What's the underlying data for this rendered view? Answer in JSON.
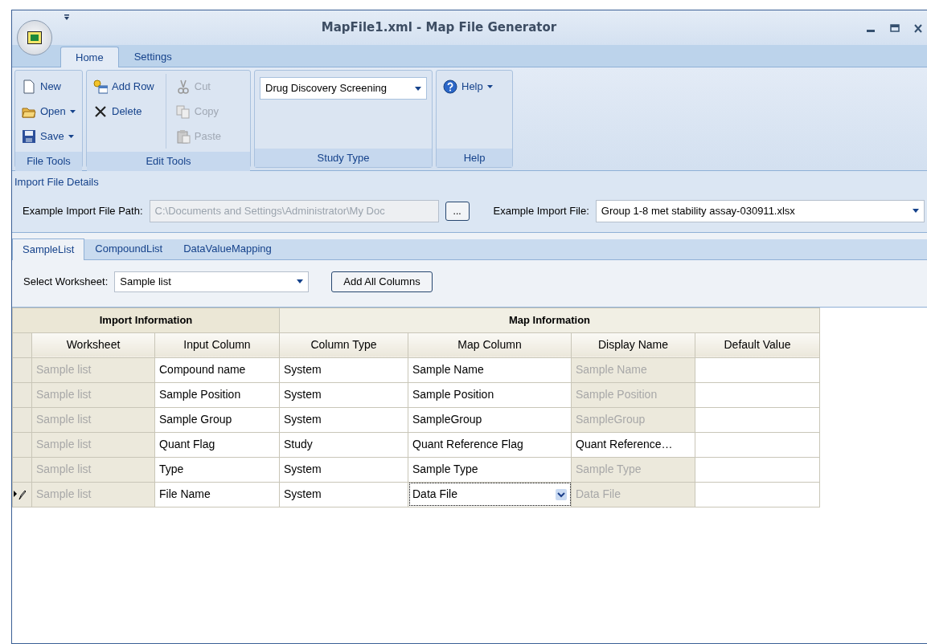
{
  "window": {
    "title": "MapFile1.xml - Map File Generator"
  },
  "ribbon_tabs": [
    {
      "label": "Home",
      "selected": true
    },
    {
      "label": "Settings",
      "selected": false
    }
  ],
  "ribbon_groups": [
    {
      "label": "File Tools",
      "kind": "buttons",
      "items": [
        {
          "label": "New",
          "dropdown": false,
          "disabled": false
        },
        {
          "label": "Open",
          "dropdown": true,
          "disabled": false
        },
        {
          "label": "Save",
          "dropdown": true,
          "disabled": false
        }
      ]
    },
    {
      "label": "Edit Tools",
      "kind": "buttons",
      "items": [
        {
          "label": "Add Row",
          "dropdown": false,
          "disabled": false
        },
        {
          "label": "Delete",
          "dropdown": false,
          "disabled": false
        },
        {
          "label": "Cut",
          "dropdown": false,
          "disabled": true
        },
        {
          "label": "Copy",
          "dropdown": false,
          "disabled": true
        },
        {
          "label": "Paste",
          "dropdown": false,
          "disabled": true
        }
      ]
    },
    {
      "label": "Study Type",
      "kind": "select",
      "value": "Drug Discovery Screening"
    },
    {
      "label": "Help",
      "kind": "buttons",
      "items": [
        {
          "label": "Help",
          "dropdown": true,
          "disabled": false
        }
      ]
    }
  ],
  "import_details": {
    "title": "Import File Details",
    "path_label": "Example Import File Path:",
    "path_value": "C:\\Documents and Settings\\Administrator\\My Doc",
    "browse_button": "...",
    "file_label": "Example Import File:",
    "file_value": "Group 1-8 met stability assay-030911.xlsx"
  },
  "content_tabs": [
    {
      "label": "SampleList",
      "selected": true
    },
    {
      "label": "CompoundList",
      "selected": false
    },
    {
      "label": "DataValueMapping",
      "selected": false
    }
  ],
  "worksheet": {
    "label": "Select Worksheet:",
    "value": "Sample list",
    "add_button": "Add All Columns"
  },
  "grid": {
    "groups": [
      {
        "label": "Import Information",
        "columns": [
          "Worksheet",
          "Input Column"
        ]
      },
      {
        "label": "Map Information",
        "columns": [
          "Column Type",
          "Map Column",
          "Display Name",
          "Default Value"
        ]
      }
    ],
    "rows": [
      {
        "current": false,
        "cells": [
          {
            "text": "Sample list",
            "readonly": true
          },
          {
            "text": "Compound name",
            "readonly": false
          },
          {
            "text": "System",
            "readonly": false
          },
          {
            "text": "Sample Name",
            "readonly": false,
            "editing": false
          },
          {
            "text": "Sample Name",
            "readonly": true
          }
        ]
      },
      {
        "current": false,
        "cells": [
          {
            "text": "Sample list",
            "readonly": true
          },
          {
            "text": "Sample Position",
            "readonly": false
          },
          {
            "text": "System",
            "readonly": false
          },
          {
            "text": "Sample Position",
            "readonly": false,
            "editing": false
          },
          {
            "text": "Sample Position",
            "readonly": true
          }
        ]
      },
      {
        "current": false,
        "cells": [
          {
            "text": "Sample list",
            "readonly": true
          },
          {
            "text": "Sample Group",
            "readonly": false
          },
          {
            "text": "System",
            "readonly": false
          },
          {
            "text": "SampleGroup",
            "readonly": false,
            "editing": false
          },
          {
            "text": "SampleGroup",
            "readonly": true
          }
        ]
      },
      {
        "current": false,
        "cells": [
          {
            "text": "Sample list",
            "readonly": true
          },
          {
            "text": "Quant Flag",
            "readonly": false
          },
          {
            "text": "Study",
            "readonly": false
          },
          {
            "text": "Quant Reference Flag",
            "readonly": false,
            "editing": false
          },
          {
            "text": "Quant  Reference…",
            "readonly": false
          }
        ]
      },
      {
        "current": false,
        "cells": [
          {
            "text": "Sample list",
            "readonly": true
          },
          {
            "text": "Type",
            "readonly": false
          },
          {
            "text": "System",
            "readonly": false
          },
          {
            "text": "Sample Type",
            "readonly": false,
            "editing": false
          },
          {
            "text": "Sample Type",
            "readonly": true
          }
        ]
      },
      {
        "current": true,
        "cells": [
          {
            "text": "Sample list",
            "readonly": true
          },
          {
            "text": "File Name",
            "readonly": false
          },
          {
            "text": "System",
            "readonly": false
          },
          {
            "text": "Data File",
            "readonly": false,
            "editing": true
          },
          {
            "text": "Data File",
            "readonly": true
          }
        ]
      }
    ]
  }
}
